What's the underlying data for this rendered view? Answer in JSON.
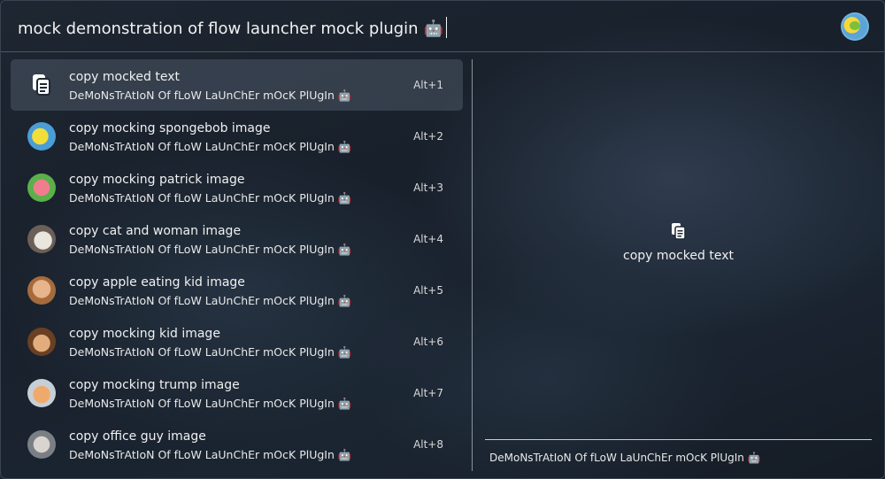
{
  "search": {
    "query": "mock demonstration of flow launcher mock plugin",
    "query_emoji": "🤖"
  },
  "results": [
    {
      "title": "copy mocked text",
      "subtitle": "DeMoNsTrAtIoN Of fLoW LaUnChEr mOcK PlUgIn 🤖",
      "hotkey": "Alt+1",
      "icon": "copy-icon",
      "selected": true
    },
    {
      "title": "copy mocking spongebob image",
      "subtitle": "DeMoNsTrAtIoN Of fLoW LaUnChEr mOcK PlUgIn 🤖",
      "hotkey": "Alt+2",
      "icon": "spongebob-thumbnail-icon"
    },
    {
      "title": "copy mocking patrick image",
      "subtitle": "DeMoNsTrAtIoN Of fLoW LaUnChEr mOcK PlUgIn 🤖",
      "hotkey": "Alt+3",
      "icon": "patrick-thumbnail-icon"
    },
    {
      "title": "copy cat and woman image",
      "subtitle": "DeMoNsTrAtIoN Of fLoW LaUnChEr mOcK PlUgIn 🤖",
      "hotkey": "Alt+4",
      "icon": "cat-thumbnail-icon"
    },
    {
      "title": "copy apple eating kid image",
      "subtitle": "DeMoNsTrAtIoN Of fLoW LaUnChEr mOcK PlUgIn 🤖",
      "hotkey": "Alt+5",
      "icon": "apple-kid-thumbnail-icon"
    },
    {
      "title": "copy mocking kid image",
      "subtitle": "DeMoNsTrAtIoN Of fLoW LaUnChEr mOcK PlUgIn 🤖",
      "hotkey": "Alt+6",
      "icon": "kid-thumbnail-icon"
    },
    {
      "title": "copy mocking trump image",
      "subtitle": "DeMoNsTrAtIoN Of fLoW LaUnChEr mOcK PlUgIn 🤖",
      "hotkey": "Alt+7",
      "icon": "trump-thumbnail-icon"
    },
    {
      "title": "copy office guy image",
      "subtitle": "DeMoNsTrAtIoN Of fLoW LaUnChEr mOcK PlUgIn 🤖",
      "hotkey": "Alt+8",
      "icon": "office-guy-thumbnail-icon"
    }
  ],
  "preview": {
    "title": "copy mocked text",
    "subtitle": "DeMoNsTrAtIoN Of fLoW LaUnChEr mOcK PlUgIn 🤖",
    "icon": "copy-icon"
  },
  "colors": {
    "selected_row": "#3d4a5a",
    "text": "#f0f0f0"
  }
}
